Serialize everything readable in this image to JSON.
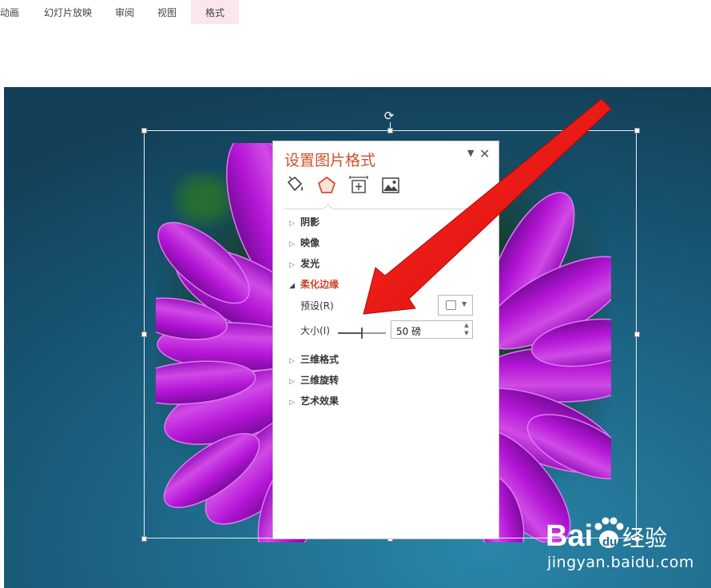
{
  "ribbon": {
    "tabs": [
      {
        "label": "动画"
      },
      {
        "label": "幻灯片放映"
      },
      {
        "label": "审阅"
      },
      {
        "label": "视图"
      },
      {
        "label": "格式",
        "active": true
      }
    ]
  },
  "pane": {
    "title": "设置图片格式",
    "close": "✕",
    "menu": "▼",
    "icons": [
      "fill-line-icon",
      "effects-icon",
      "size-properties-icon",
      "picture-icon"
    ],
    "active_icon": "effects-icon",
    "sections": [
      {
        "label": "阴影",
        "expanded": false
      },
      {
        "label": "映像",
        "expanded": false
      },
      {
        "label": "发光",
        "expanded": false
      },
      {
        "label": "柔化边缘",
        "expanded": true
      },
      {
        "label": "三维格式",
        "expanded": false
      },
      {
        "label": "三维旋转",
        "expanded": false
      },
      {
        "label": "艺术效果",
        "expanded": false
      }
    ],
    "soft_edges": {
      "preset_label": "预设(R)",
      "size_label": "大小(I)",
      "size_value": "50 磅",
      "size_slider_fraction": 0.5
    }
  },
  "watermark": {
    "brand": "Baidu经验",
    "url": "jingyan.baidu.com"
  },
  "colors": {
    "accent": "#d0512e",
    "petal": "#b414d4",
    "arrow": "#e21010",
    "slide_bg": "#175573"
  }
}
